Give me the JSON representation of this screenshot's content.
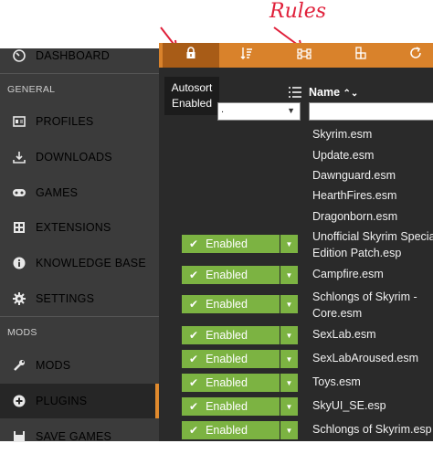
{
  "annotation": {
    "text": "Rules"
  },
  "sidebar": {
    "items": [
      {
        "label": "DASHBOARD",
        "icon": "dashboard-icon"
      },
      {
        "label": "PROFILES",
        "icon": "profiles-icon"
      },
      {
        "label": "DOWNLOADS",
        "icon": "download-icon"
      },
      {
        "label": "GAMES",
        "icon": "gamepad-icon"
      },
      {
        "label": "EXTENSIONS",
        "icon": "extensions-icon"
      },
      {
        "label": "KNOWLEDGE BASE",
        "icon": "info-icon"
      },
      {
        "label": "SETTINGS",
        "icon": "gear-icon"
      },
      {
        "label": "MODS",
        "icon": "wrench-icon"
      },
      {
        "label": "PLUGINS",
        "icon": "plus-circle-icon"
      },
      {
        "label": "SAVE GAMES",
        "icon": "save-icon"
      }
    ],
    "sections": {
      "general": "GENERAL",
      "mods": "MODS"
    },
    "active": "PLUGINS"
  },
  "toolbar": {
    "buttons": [
      "lock-icon",
      "sort-icon",
      "rules-icon",
      "puzzle-icon",
      "refresh-icon"
    ],
    "active": "lock-icon"
  },
  "tooltip": {
    "line1": "Autosort",
    "line2": "Enabled"
  },
  "table": {
    "name_header": "Name",
    "status_filter_value": ".",
    "name_filter_value": "",
    "enabled_label": "Enabled",
    "plugins": [
      {
        "name": "Skyrim.esm",
        "enabled": false
      },
      {
        "name": "Update.esm",
        "enabled": false
      },
      {
        "name": "Dawnguard.esm",
        "enabled": false
      },
      {
        "name": "HearthFires.esm",
        "enabled": false
      },
      {
        "name": "Dragonborn.esm",
        "enabled": false
      },
      {
        "name": "Unofficial Skyrim Special",
        "name2": "Edition Patch.esp",
        "enabled": true
      },
      {
        "name": "Campfire.esm",
        "enabled": true
      },
      {
        "name": "Schlongs of Skyrim -",
        "name2": "Core.esm",
        "enabled": true
      },
      {
        "name": "SexLab.esm",
        "enabled": true
      },
      {
        "name": "SexLabAroused.esm",
        "enabled": true
      },
      {
        "name": "Toys.esm",
        "enabled": true
      },
      {
        "name": "SkyUI_SE.esp",
        "enabled": true
      },
      {
        "name": "Schlongs of Skyrim.esp",
        "enabled": true
      }
    ]
  },
  "colors": {
    "accent": "#d9822b",
    "enabled": "#7cb342",
    "sidebar": "#3b3b3b",
    "annotation": "#e0203a"
  }
}
